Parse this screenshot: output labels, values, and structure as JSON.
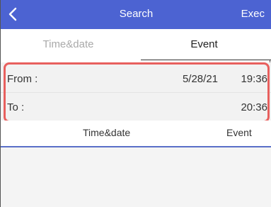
{
  "header": {
    "title": "Search",
    "exec_label": "Exec",
    "back_icon": "chevron-left-icon",
    "bar_color": "#4c63d2"
  },
  "tabs": [
    {
      "label": "Time&date",
      "active": false
    },
    {
      "label": "Event",
      "active": true
    }
  ],
  "range": {
    "from_label": "From :",
    "from_date": "5/28/21",
    "from_time": "19:36",
    "to_label": "To :",
    "to_time": "20:36",
    "highlight_color": "#e8605e"
  },
  "table": {
    "columns": [
      "Time&date",
      "Event"
    ],
    "rows": []
  }
}
